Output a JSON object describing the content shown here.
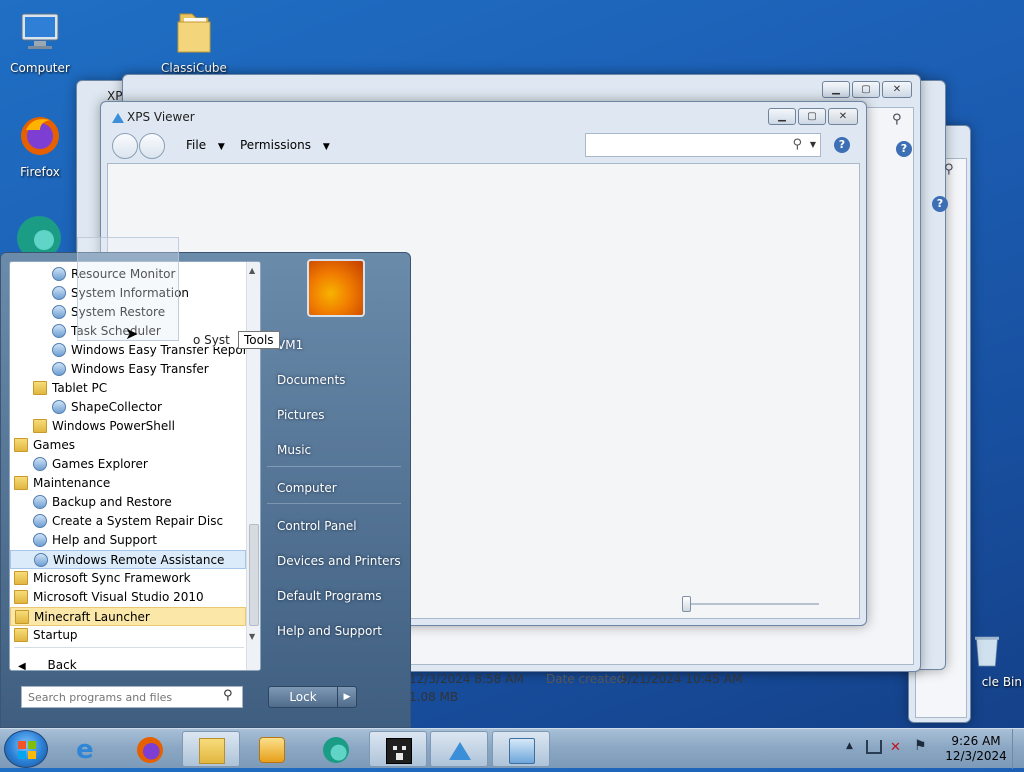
{
  "desktop": {
    "icons": [
      {
        "label": "Computer"
      },
      {
        "label": "ClassiCube"
      },
      {
        "label": "Firefox"
      },
      {
        "label": "cle Bin"
      }
    ]
  },
  "windows": {
    "back2": {
      "title": "XPS"
    },
    "front": {
      "title": "XPS Viewer",
      "menu": {
        "file": "File",
        "permissions": "Permissions"
      }
    }
  },
  "details": {
    "modified": "12/3/2024 8:58 AM",
    "created_label": "Date created:",
    "created": "9/21/2024 10:45 AM",
    "size": "1.08 MB"
  },
  "start_menu": {
    "programs": [
      {
        "label": "Resource Monitor",
        "type": "app",
        "indent": 2
      },
      {
        "label": "System Information",
        "type": "app",
        "indent": 2
      },
      {
        "label": "System Restore",
        "type": "app",
        "indent": 2
      },
      {
        "label": "Task Scheduler",
        "type": "app",
        "indent": 2
      },
      {
        "label": "Windows Easy Transfer Reports",
        "type": "app",
        "indent": 2
      },
      {
        "label": "Windows Easy Transfer",
        "type": "app",
        "indent": 2
      },
      {
        "label": "Tablet PC",
        "type": "folder",
        "indent": 1
      },
      {
        "label": "ShapeCollector",
        "type": "app",
        "indent": 2
      },
      {
        "label": "Windows PowerShell",
        "type": "folder",
        "indent": 1
      },
      {
        "label": "Games",
        "type": "folder",
        "indent": 0
      },
      {
        "label": "Games Explorer",
        "type": "app",
        "indent": 1
      },
      {
        "label": "Maintenance",
        "type": "folder",
        "indent": 0
      },
      {
        "label": "Backup and Restore",
        "type": "app",
        "indent": 1
      },
      {
        "label": "Create a System Repair Disc",
        "type": "app",
        "indent": 1
      },
      {
        "label": "Help and Support",
        "type": "app",
        "indent": 1
      },
      {
        "label": "Windows Remote Assistance",
        "type": "app",
        "indent": 1,
        "state": "selected"
      },
      {
        "label": "Microsoft Sync Framework",
        "type": "folder",
        "indent": 0
      },
      {
        "label": "Microsoft Visual Studio 2010",
        "type": "folder",
        "indent": 0
      },
      {
        "label": "Minecraft Launcher",
        "type": "folder",
        "indent": 0,
        "state": "highlighted"
      },
      {
        "label": "Startup",
        "type": "folder",
        "indent": 0
      }
    ],
    "back_label": "Back",
    "search_placeholder": "Search programs and files",
    "drag_tooltip": "Tools",
    "drag_text": "o Syst",
    "right_pane": [
      "VM1",
      "Documents",
      "Pictures",
      "Music",
      "Computer",
      "Control Panel",
      "Devices and Printers",
      "Default Programs",
      "Help and Support"
    ],
    "lock_label": "Lock"
  },
  "taskbar": {
    "time": "9:26 AM",
    "date": "12/3/2024"
  },
  "colors": {
    "highlight": "#fbe8a8",
    "selected": "#dcebf9"
  }
}
